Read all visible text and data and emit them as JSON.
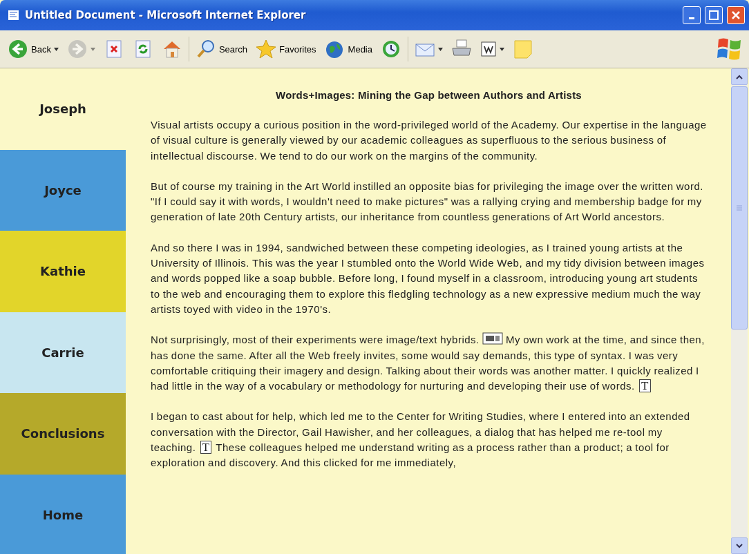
{
  "window": {
    "title": "Untitled Document - Microsoft Internet Explorer"
  },
  "toolbar": [
    {
      "kind": "back",
      "label": "Back",
      "disabled": false,
      "menu": true
    },
    {
      "kind": "forward",
      "disabled": true,
      "menu": true
    },
    {
      "kind": "stop",
      "disabled": false
    },
    {
      "kind": "refresh",
      "disabled": false
    },
    {
      "kind": "home",
      "disabled": false
    },
    {
      "kind": "search",
      "label": "Search",
      "disabled": false
    },
    {
      "kind": "favorites",
      "label": "Favorites",
      "disabled": false
    },
    {
      "kind": "media",
      "label": "Media",
      "disabled": false
    },
    {
      "kind": "history",
      "disabled": false
    },
    {
      "kind": "mail",
      "disabled": false,
      "menu": true
    },
    {
      "kind": "print",
      "disabled": false
    },
    {
      "kind": "edit",
      "disabled": false,
      "menu": true
    },
    {
      "kind": "note",
      "disabled": false
    }
  ],
  "sidebar": {
    "items": [
      {
        "label": "Joseph",
        "color": "#fbf8c8"
      },
      {
        "label": "Joyce",
        "color": "#4a9ad8"
      },
      {
        "label": "Kathie",
        "color": "#e2d52a"
      },
      {
        "label": "Carrie",
        "color": "#c8e6f0"
      },
      {
        "label": "Conclusions",
        "color": "#b5a92a"
      },
      {
        "label": "Home",
        "color": "#4a9ad8"
      }
    ]
  },
  "article": {
    "heading": "Words+Images: Mining the Gap between Authors and Artists",
    "paragraphs": [
      [
        {
          "kind": "text",
          "text": "Visual artists occupy a curious position in the word-privileged world of the Academy. Our expertise in the language of visual culture is generally viewed by our academic colleagues as superfluous to the serious business of intellectual discourse. We tend to do our work on the margins of the community."
        }
      ],
      [
        {
          "kind": "text",
          "text": "But of course my training in the Art World instilled an opposite bias for privileging the image over the written word. \"If I could say it with words, I wouldn't need to make pictures\" was a rallying crying and membership badge for my generation of late 20th Century artists, our inheritance from countless generations of Art World ancestors."
        }
      ],
      [
        {
          "kind": "text",
          "text": "And so there I was in 1994, sandwiched between these competing ideologies, as I trained young artists at the University of Illinois. This was the year I stumbled onto the World Wide Web, and my tidy division between images and words popped like a soap bubble. Before long, I found myself in a classroom, introducing young art students to the web and encouraging them to explore this fledgling technology as a new expressive medium much the way artists toyed with video in the 1970's."
        }
      ],
      [
        {
          "kind": "text",
          "text": "Not surprisingly, most of their experiments were image/text hybrids."
        },
        {
          "kind": "image-link"
        },
        {
          "kind": "text",
          "text": "My own work at the time, and since then, has done the same. After all the Web freely invites, some would say demands, this type of syntax. I was very comfortable critiquing their imagery and design. Talking about their words was another matter. I quickly realized I had little in the way of a vocabulary or methodology for nurturing and developing their use of words."
        },
        {
          "kind": "text-link",
          "text": "T"
        }
      ],
      [
        {
          "kind": "text",
          "text": "I began to cast about for help, which led me to the Center for Writing Studies, where I entered into an extended conversation with the Director, Gail Hawisher, and her colleagues, a dialog that has helped me re-tool my teaching."
        },
        {
          "kind": "text-link",
          "text": "T"
        },
        {
          "kind": "text",
          "text": "These colleagues helped me understand writing as a process rather than a product; a tool for exploration and discovery. And this clicked for me immediately,"
        }
      ]
    ]
  }
}
